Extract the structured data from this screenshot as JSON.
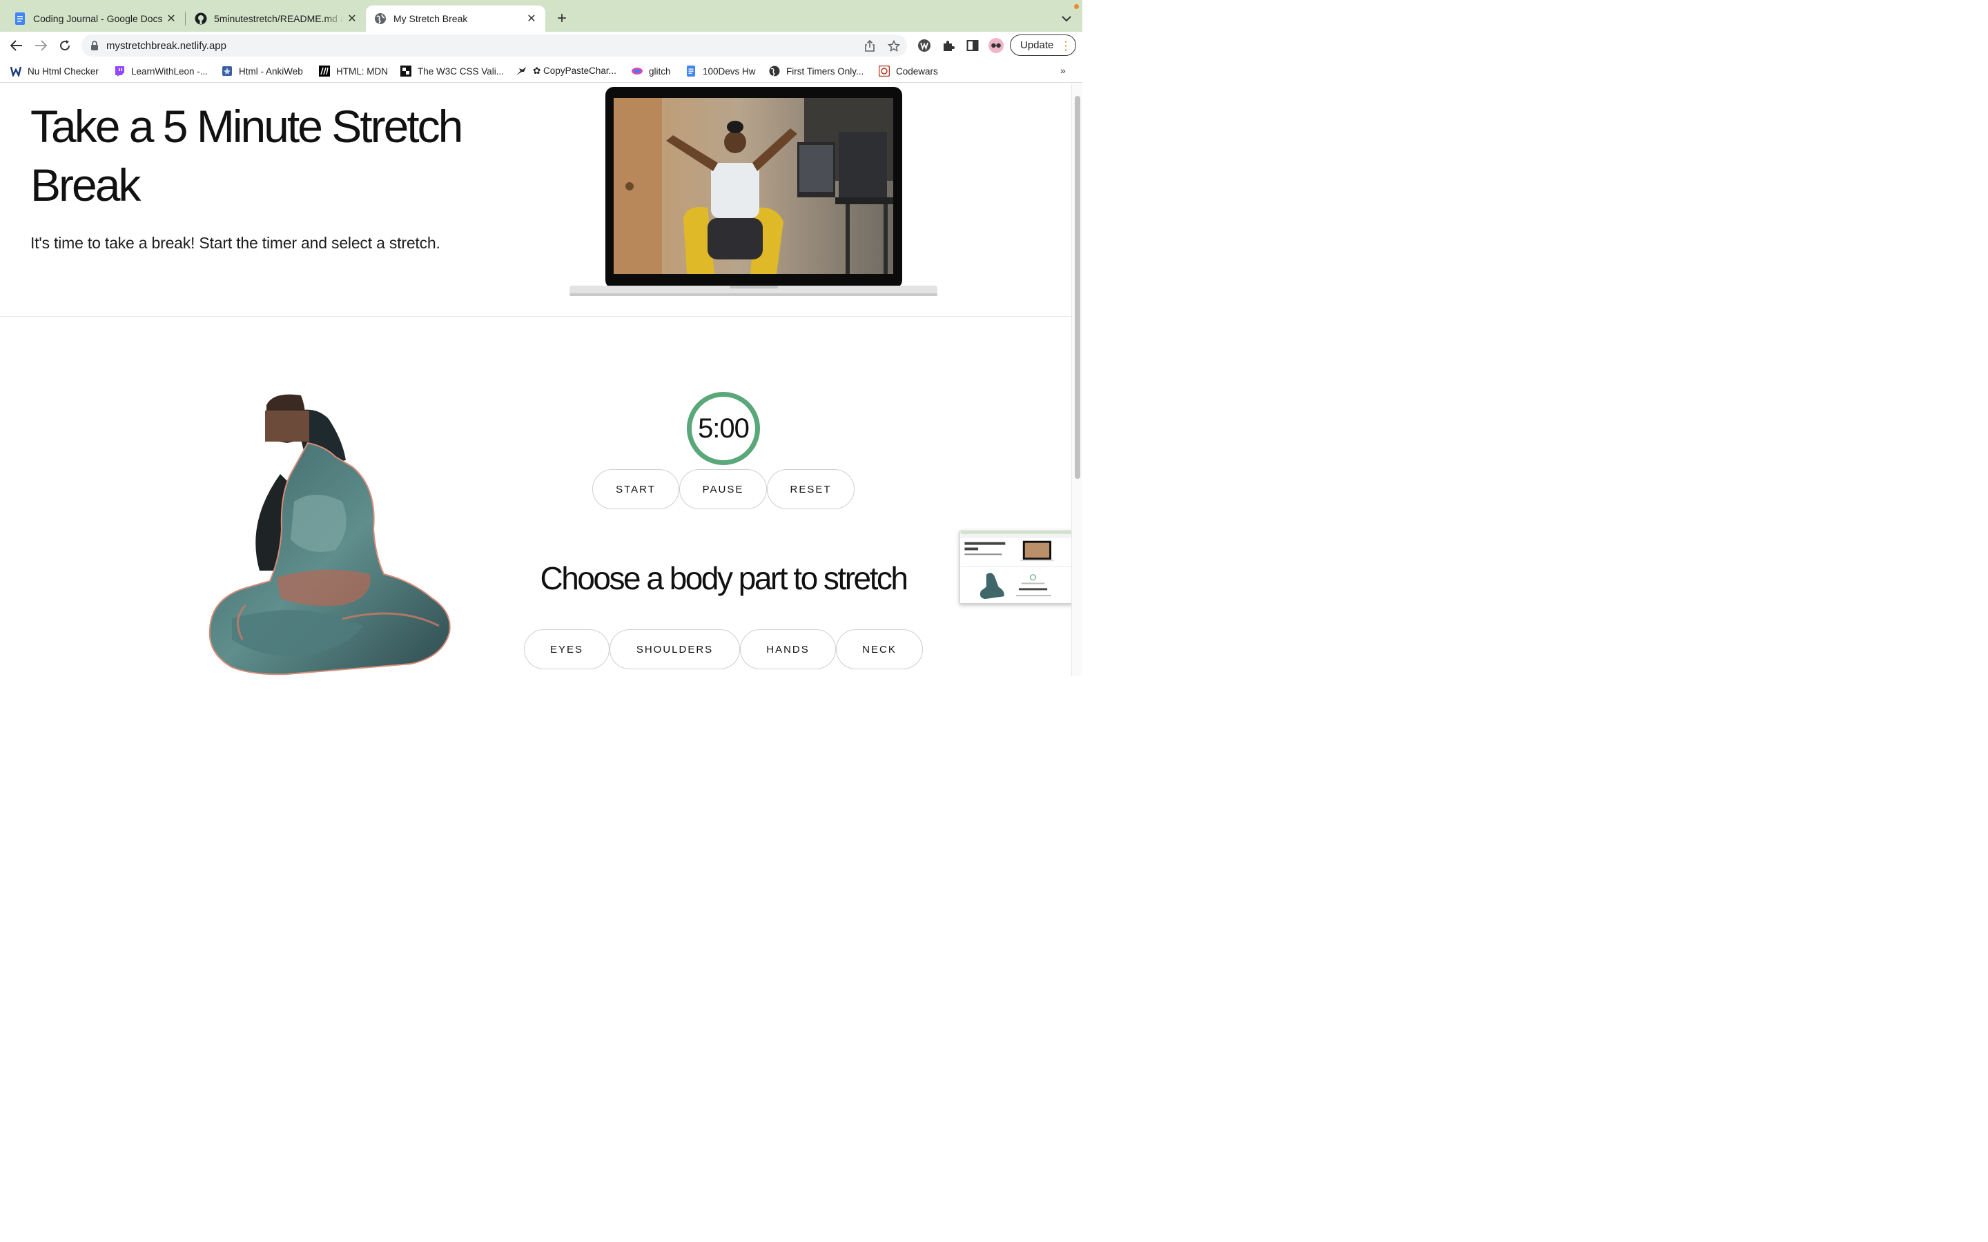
{
  "browser": {
    "tabs": [
      {
        "title": "Coding Journal - Google Docs",
        "icon": "google-docs-icon",
        "active": false
      },
      {
        "title": "5minutestretch/README.md at",
        "icon": "github-icon",
        "active": false
      },
      {
        "title": "My Stretch Break",
        "icon": "globe-icon",
        "active": true
      }
    ],
    "url": "mystretchbreak.netlify.app",
    "update_label": "Update",
    "bookmarks": [
      {
        "label": "Nu Html Checker",
        "icon": "w3c-validator-icon"
      },
      {
        "label": "LearnWithLeon -...",
        "icon": "twitch-icon"
      },
      {
        "label": "Html - AnkiWeb",
        "icon": "anki-icon"
      },
      {
        "label": "HTML: MDN",
        "icon": "mdn-icon"
      },
      {
        "label": "The W3C CSS Vali...",
        "icon": "puzzle-icon"
      },
      {
        "label": "✿ CopyPasteChar...",
        "icon": "bird-icon"
      },
      {
        "label": "glitch",
        "icon": "glitch-icon"
      },
      {
        "label": "100Devs Hw",
        "icon": "google-docs-icon"
      },
      {
        "label": "First Timers Only...",
        "icon": "globe-icon"
      },
      {
        "label": "Codewars",
        "icon": "codewars-icon"
      }
    ],
    "bookmarks_overflow": "»"
  },
  "page": {
    "title": "Take a 5 Minute Stretch Break",
    "subtitle": "It's time to take a break! Start the timer and select a stretch.",
    "timer": "5:00",
    "controls": {
      "start": "START",
      "pause": "PAUSE",
      "reset": "RESET"
    },
    "choose_heading": "Choose a body part to stretch",
    "body_parts": [
      "EYES",
      "SHOULDERS",
      "HANDS",
      "NECK"
    ]
  },
  "colors": {
    "tabstrip": "#d3e3c8",
    "timer_ring": "#5aa77a",
    "update_dot": "#e98a35"
  }
}
